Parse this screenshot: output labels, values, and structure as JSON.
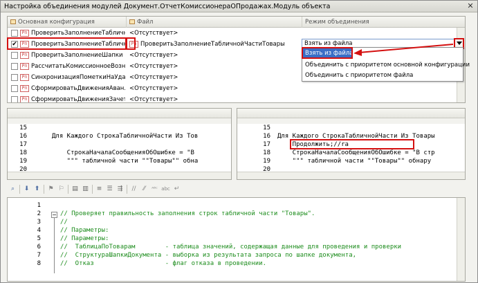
{
  "window": {
    "title": "Настройка объединения модулей Документ.ОтчетКомиссионераОПродажах.Модуль объекта",
    "close": "✕"
  },
  "grid": {
    "headers": [
      "Основная конфигурация",
      "Файл",
      "Режим объединения"
    ],
    "rows": [
      {
        "main": "ПроверитьЗаполнениеТабличн...",
        "file": "<Отсутствует>",
        "mode": "",
        "checked": false
      },
      {
        "main": "ПроверитьЗаполнениеТабличн...",
        "file": "ПроверитьЗаполнениеТабличнойЧастиТовары",
        "mode": "Взять из файла",
        "checked": true
      },
      {
        "main": "ПроверитьЗаполнениеШапки",
        "file": "<Отсутствует>",
        "mode": "",
        "checked": false
      },
      {
        "main": "РассчитатьКомиссионноеВозн...",
        "file": "<Отсутствует>",
        "mode": "",
        "checked": false
      },
      {
        "main": "СинхронизацияПометкиНаУда...",
        "file": "<Отсутствует>",
        "mode": "",
        "checked": false
      },
      {
        "main": "СформироватьДвиженияАван...",
        "file": "<Отсутствует>",
        "mode": "",
        "checked": false
      },
      {
        "main": "СформироватьДвиженияЗачет...",
        "file": "<Отсутствует>",
        "mode": "",
        "checked": false
      }
    ],
    "dropdown_options": [
      "Взять из файла",
      "Объединить с приоритетом основной конфигурации",
      "Объединить с приоритетом файла"
    ],
    "dropdown_selected": "Взять из файла"
  },
  "left_code": {
    "lines": [
      {
        "n": "15",
        "text": ""
      },
      {
        "n": "16",
        "text": "Для Каждого СтрокаТабличнойЧасти Из Тов"
      },
      {
        "n": "17",
        "text": ""
      },
      {
        "n": "18",
        "text": "    СтрокаНачалаСообщенияОбОшибке = \"В"
      },
      {
        "n": "19",
        "text": "    \"\"\" табличной части \"\"Товары\"\" обна"
      },
      {
        "n": "20",
        "text": ""
      }
    ]
  },
  "right_code": {
    "lines": [
      {
        "n": "15",
        "text": ""
      },
      {
        "n": "16",
        "text": "Для Каждого СтрокаТабличнойЧасти Из Товары"
      },
      {
        "n": "17",
        "text": "    Продолжить;//ra"
      },
      {
        "n": "18",
        "text": "    СтрокаНачалаСообщенияОбОшибке = \"В стр"
      },
      {
        "n": "19",
        "text": "    \"\"\" табличной части \"\"Товары\"\" обнару"
      },
      {
        "n": "20",
        "text": ""
      }
    ]
  },
  "bottom_code": {
    "lines": [
      {
        "n": "1",
        "text": ""
      },
      {
        "n": "2",
        "text": "// Проверяет правильность заполнения строк табличной части \"Товары\"."
      },
      {
        "n": "3",
        "text": "//"
      },
      {
        "n": "4",
        "text": "// Параметры:"
      },
      {
        "n": "5",
        "text": "// Параметры:"
      },
      {
        "n": "6",
        "text": "//  ТаблицаПоТоварам        - таблица значений, содержащая данные для проведения и проверки"
      },
      {
        "n": "7",
        "text": "//  СтруктураШапкиДокумента - выборка из результата запроса по шапке документа,"
      },
      {
        "n": "8",
        "text": "//  Отказ                   - флаг отказа в проведении."
      }
    ]
  },
  "colors": {
    "highlight_box": "#d41010",
    "comment": "#1c8c1c",
    "selection": "#3a6ec6"
  }
}
